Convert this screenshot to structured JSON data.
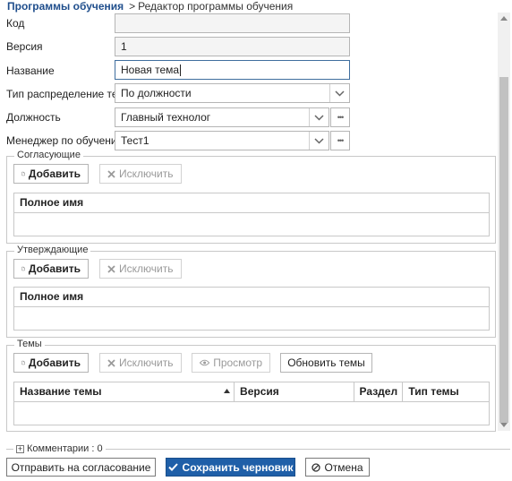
{
  "breadcrumb": {
    "parent": "Программы обучения",
    "separator": ">",
    "current": "Редактор программы обучения"
  },
  "form": {
    "code": {
      "label": "Код",
      "value": ""
    },
    "version": {
      "label": "Версия",
      "value": "1"
    },
    "name": {
      "label": "Название",
      "value": "Новая тема"
    },
    "distribution_type": {
      "label": "Тип распределение тем",
      "value": "По должности"
    },
    "position": {
      "label": "Должность",
      "value": "Главный технолог"
    },
    "manager": {
      "label": "Менеджер по обучению",
      "value": "Тест1"
    }
  },
  "approvers": {
    "title": "Согласующие",
    "add_label": "Добавить",
    "remove_label": "Исключить",
    "columns": [
      "Полное имя"
    ]
  },
  "confirmers": {
    "title": "Утверждающие",
    "add_label": "Добавить",
    "remove_label": "Исключить",
    "columns": [
      "Полное имя"
    ]
  },
  "topics": {
    "title": "Темы",
    "add_label": "Добавить",
    "remove_label": "Исключить",
    "view_label": "Просмотр",
    "refresh_label": "Обновить темы",
    "columns": [
      "Название темы",
      "Версия",
      "Раздел",
      "Тип темы"
    ]
  },
  "comments": {
    "label": "Комментарии : 0"
  },
  "footer": {
    "send_label": "Отправить на согласование",
    "save_label": "Сохранить черновик",
    "cancel_label": "Отмена"
  },
  "colors": {
    "primary": "#1f5fa8",
    "link": "#1f4e8c",
    "border": "#b5b5b5"
  },
  "icons": [
    "document-icon",
    "close-x-icon",
    "eye-icon",
    "chevron-down-icon",
    "more-icon",
    "check-icon",
    "cancel-icon",
    "plus-box-icon",
    "sort-asc-icon"
  ]
}
